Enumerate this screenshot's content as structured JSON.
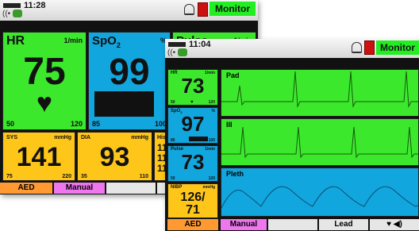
{
  "back": {
    "time": "11:28",
    "mode_label": "Monitor",
    "hr": {
      "label": "HR",
      "unit": "1/min",
      "value": "75",
      "low": "50",
      "high": "120"
    },
    "spo2": {
      "label": "SpO",
      "sub": "2",
      "unit": "%",
      "value": "99",
      "low": "85",
      "high": "100"
    },
    "pulse": {
      "label": "Pulse",
      "unit": "1/min"
    },
    "sys": {
      "label": "SYS",
      "unit": "mmHg",
      "value": "141",
      "low": "75",
      "high": "220"
    },
    "dia": {
      "label": "DIA",
      "unit": "mmHg",
      "value": "93",
      "low": "35",
      "high": "110"
    },
    "hist": {
      "label": "Hist",
      "values": [
        "11",
        "11",
        "11"
      ]
    },
    "softkeys": [
      "AED",
      "Manual",
      "",
      ""
    ]
  },
  "front": {
    "time": "11:04",
    "mode_label": "Monitor",
    "hr": {
      "label": "HR",
      "unit": "1/min",
      "value": "73",
      "low": "50",
      "high": "120"
    },
    "spo2": {
      "label": "SpO",
      "sub": "2",
      "unit": "%",
      "value": "97",
      "low": "85",
      "high": "100"
    },
    "pulse": {
      "label": "Pulse",
      "unit": "1/min",
      "value": "73",
      "low": "50",
      "high": "120"
    },
    "nibp": {
      "label": "NIBP",
      "unit": "mmHg",
      "value_top": "126/",
      "value_bottom": "71"
    },
    "waves": {
      "pad": "Pad",
      "lead2": "III",
      "pleth": "Pleth"
    },
    "softkeys": [
      "AED",
      "Manual",
      "",
      "Lead",
      "♥ ◀)"
    ]
  }
}
